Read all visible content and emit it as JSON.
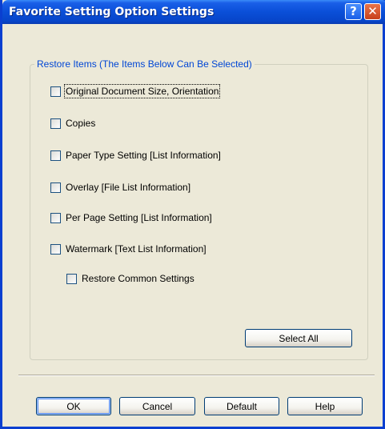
{
  "window": {
    "title": "Favorite Setting Option Settings",
    "help_glyph": "?",
    "close_glyph": "✕"
  },
  "group": {
    "label": "Restore Items (The Items Below Can Be Selected)"
  },
  "checkboxes": [
    {
      "label": "Original Document Size, Orientation",
      "checked": false,
      "focused": true
    },
    {
      "label": "Copies",
      "checked": false
    },
    {
      "label": "Paper Type Setting [List Information]",
      "checked": false
    },
    {
      "label": "Overlay [File List Information]",
      "checked": false
    },
    {
      "label": "Per Page Setting [List Information]",
      "checked": false
    },
    {
      "label": "Watermark [Text List Information]",
      "checked": false
    },
    {
      "label": "Restore Common Settings",
      "checked": false
    }
  ],
  "buttons": {
    "select_all": "Select All",
    "ok": "OK",
    "cancel": "Cancel",
    "default": "Default",
    "help": "Help"
  },
  "colors": {
    "titlebar": "#0a4fd8",
    "dialog_bg": "#ece9d8",
    "group_label": "#0046d5"
  }
}
